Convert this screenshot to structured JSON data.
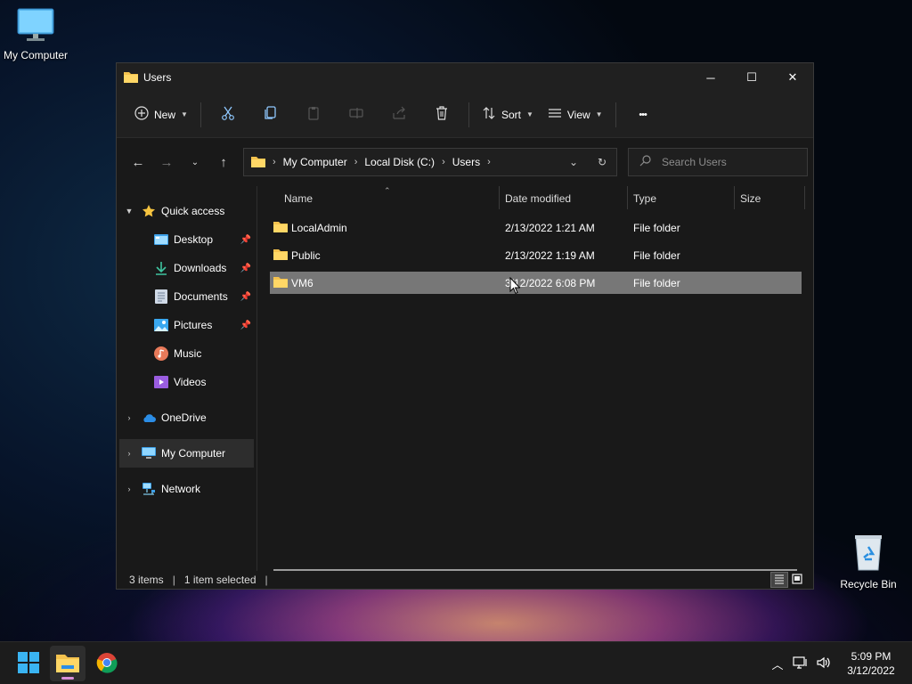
{
  "desktop": {
    "icons": [
      {
        "label": "My Computer"
      },
      {
        "label": "Recycle Bin"
      }
    ]
  },
  "window": {
    "title": "Users",
    "controls": {
      "minimize": "─",
      "maximize": "☐",
      "close": "✕"
    }
  },
  "toolbar": {
    "new_label": "New",
    "sort_label": "Sort",
    "view_label": "View",
    "more_label": "•••"
  },
  "address": {
    "crumbs": [
      "My Computer",
      "Local Disk (C:)",
      "Users"
    ]
  },
  "search": {
    "placeholder": "Search Users"
  },
  "sidebar": {
    "quick_access": "Quick access",
    "quick_items": [
      {
        "label": "Desktop",
        "pinned": true
      },
      {
        "label": "Downloads",
        "pinned": true
      },
      {
        "label": "Documents",
        "pinned": true
      },
      {
        "label": "Pictures",
        "pinned": true
      },
      {
        "label": "Music",
        "pinned": false
      },
      {
        "label": "Videos",
        "pinned": false
      }
    ],
    "onedrive": "OneDrive",
    "my_computer": "My Computer",
    "network": "Network"
  },
  "columns": {
    "name": "Name",
    "date": "Date modified",
    "type": "Type",
    "size": "Size"
  },
  "files": [
    {
      "name": "LocalAdmin",
      "date": "2/13/2022 1:21 AM",
      "type": "File folder",
      "selected": false
    },
    {
      "name": "Public",
      "date": "2/13/2022 1:19 AM",
      "type": "File folder",
      "selected": false
    },
    {
      "name": "VM6",
      "date": "3/12/2022 6:08 PM",
      "type": "File folder",
      "selected": true
    }
  ],
  "status": {
    "items": "3 items",
    "selected": "1 item selected",
    "bar": "|"
  },
  "taskbar": {
    "time": "5:09 PM",
    "date": "3/12/2022"
  },
  "colors": {
    "window_bg": "#191919",
    "selected_row": "#777777",
    "folder_yellow": "#f4c24e",
    "accent_blue": "#2aa0f0"
  }
}
